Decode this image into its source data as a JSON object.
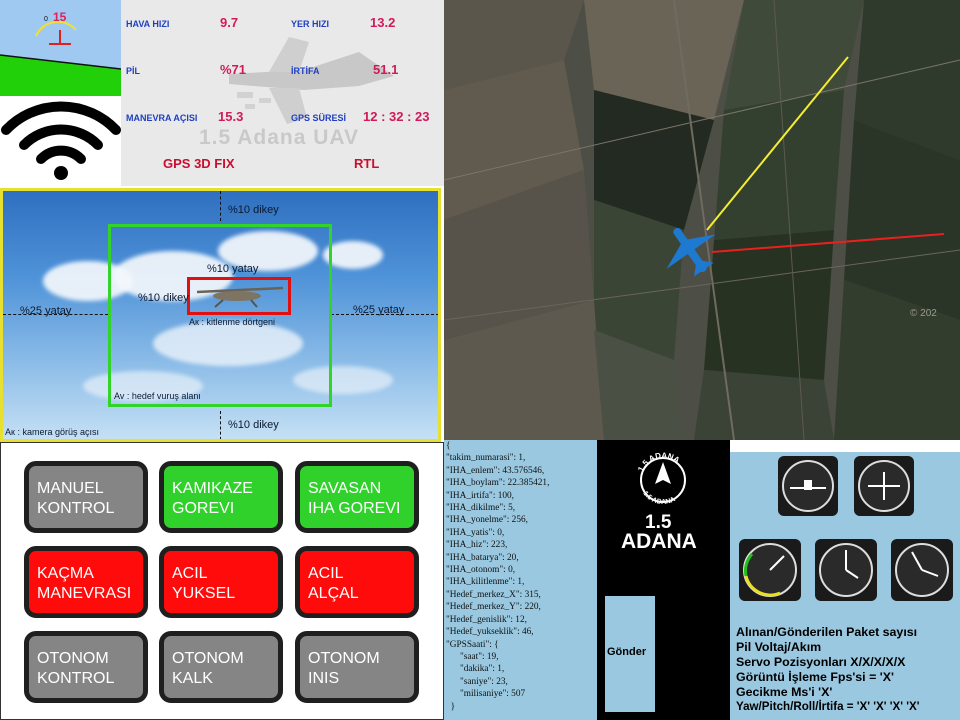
{
  "attitude": {
    "pitch_readout": "15",
    "zero_mark": "0"
  },
  "telemetry": {
    "airspeed_label": "HAVA HIZI",
    "airspeed_value": "9.7",
    "groundspeed_label": "YER HIZI",
    "groundspeed_value": "13.2",
    "battery_label": "PİL",
    "battery_value": "%71",
    "altitude_label": "İRTİFA",
    "altitude_value": "51.1",
    "maneuver_label": "MANEVRA AÇISI",
    "maneuver_value": "15.3",
    "gps_time_label": "GPS SÜRESİ",
    "gps_time_value": "12 : 32 : 23",
    "gps_status": "GPS 3D FIX",
    "mode_status": "RTL",
    "watermark": "1.5 Adana UAV"
  },
  "camera": {
    "top_vertical": "%10 dikey",
    "bottom_vertical": "%10 dikey",
    "left_horizontal": "%25 yatay",
    "right_horizontal": "%25 yatay",
    "inner_horizontal": "%10 yatay",
    "inner_vertical": "%10 dikey",
    "lock_box_label": "Aк : kitlenme dörtgeni",
    "target_area_label": "Av : hedef vuruş alanı",
    "camera_view_label": "Aк : kamera görüş açısı"
  },
  "map": {
    "watermark": "© 202"
  },
  "buttons": [
    {
      "line1": "MANUEL",
      "line2": "KONTROL",
      "color": "gray"
    },
    {
      "line1": "KAMIKAZE",
      "line2": "GOREVI",
      "color": "green"
    },
    {
      "line1": "SAVASAN",
      "line2": "IHA GOREVI",
      "color": "green"
    },
    {
      "line1": "KAÇMA",
      "line2": "MANEVRASI",
      "color": "red"
    },
    {
      "line1": "ACIL",
      "line2": "YUKSEL",
      "color": "red"
    },
    {
      "line1": "ACIL",
      "line2": "ALÇAL",
      "color": "red"
    },
    {
      "line1": "OTONOM",
      "line2": "KONTROL",
      "color": "gray"
    },
    {
      "line1": "OTONOM",
      "line2": "KALK",
      "color": "gray"
    },
    {
      "line1": "OTONOM",
      "line2": "INIS",
      "color": "gray"
    }
  ],
  "json_text": "{\n\"takim_numarasi\": 1,\n\"IHA_enlem\": 43.576546,\n\"IHA_boylam\": 22.385421,\n\"IHA_irtifa\": 100,\n\"IHA_dikilme\": 5,\n\"IHA_yonelme\": 256,\n\"IHA_yatis\": 0,\n\"IHA_hiz\": 223,\n\"IHA_batarya\": 20,\n\"IHA_otonom\": 0,\n\"IHA_kilitlenme\": 1,\n\"Hedef_merkez_X\": 315,\n\"Hedef_merkez_Y\": 220,\n\"Hedef_genislik\": 12,\n\"Hedef_yukseklik\": 46,\n\"GPSSaati\": {\n      \"saat\": 19,\n      \"dakika\": 1,\n      \"saniye\": 23,\n      \"milisaniye\": 507\n  }",
  "logo": {
    "badge_top": "1.5 ADANA",
    "badge_bottom": "1.5 ADANA",
    "line1": "1.5",
    "line2": "ADANA"
  },
  "send_button": "Gönder",
  "info_lines": [
    "Alınan/Gönderilen Paket sayısı",
    "Pil Voltaj/Akım",
    "Servo Pozisyonları X/X/X/X/X",
    "Görüntü İşleme Fps'si = 'X'",
    "Gecikme Ms'i 'X'",
    "Yaw/Pitch/Roll/İrtifa = 'X' 'X' 'X' 'X'"
  ],
  "colors": {
    "accent_blue": "#1f3fbf",
    "value_magenta": "#d01a5a",
    "green": "#31d12c",
    "red": "#ff0b0b",
    "panel_blue": "#99c8e0"
  }
}
